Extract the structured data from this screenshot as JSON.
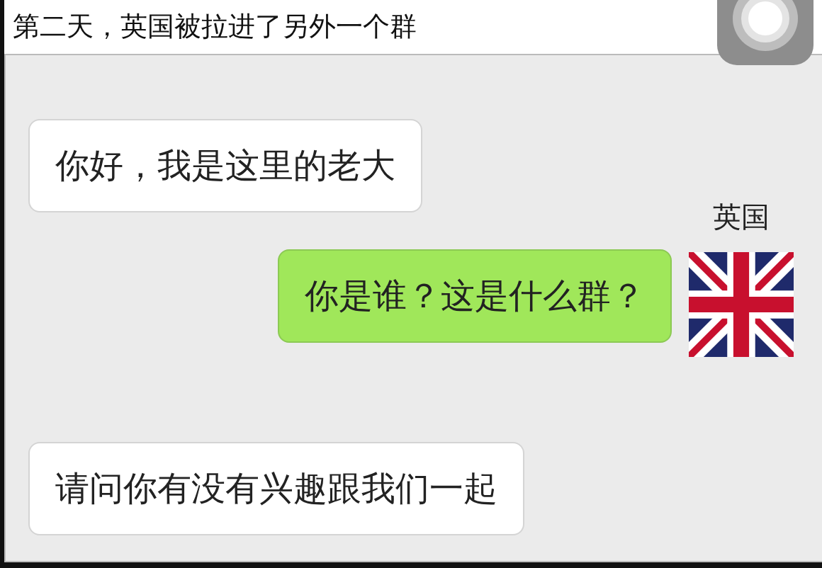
{
  "caption": "第二天，英国被拉进了另外一个群",
  "messages": [
    {
      "kind": "incoming",
      "text": "你好，我是这里的老大"
    },
    {
      "kind": "outgoing",
      "sender": "英国",
      "text": "你是谁？这是什么群？"
    },
    {
      "kind": "incoming",
      "text": "请问你有没有兴趣跟我们一起"
    }
  ]
}
